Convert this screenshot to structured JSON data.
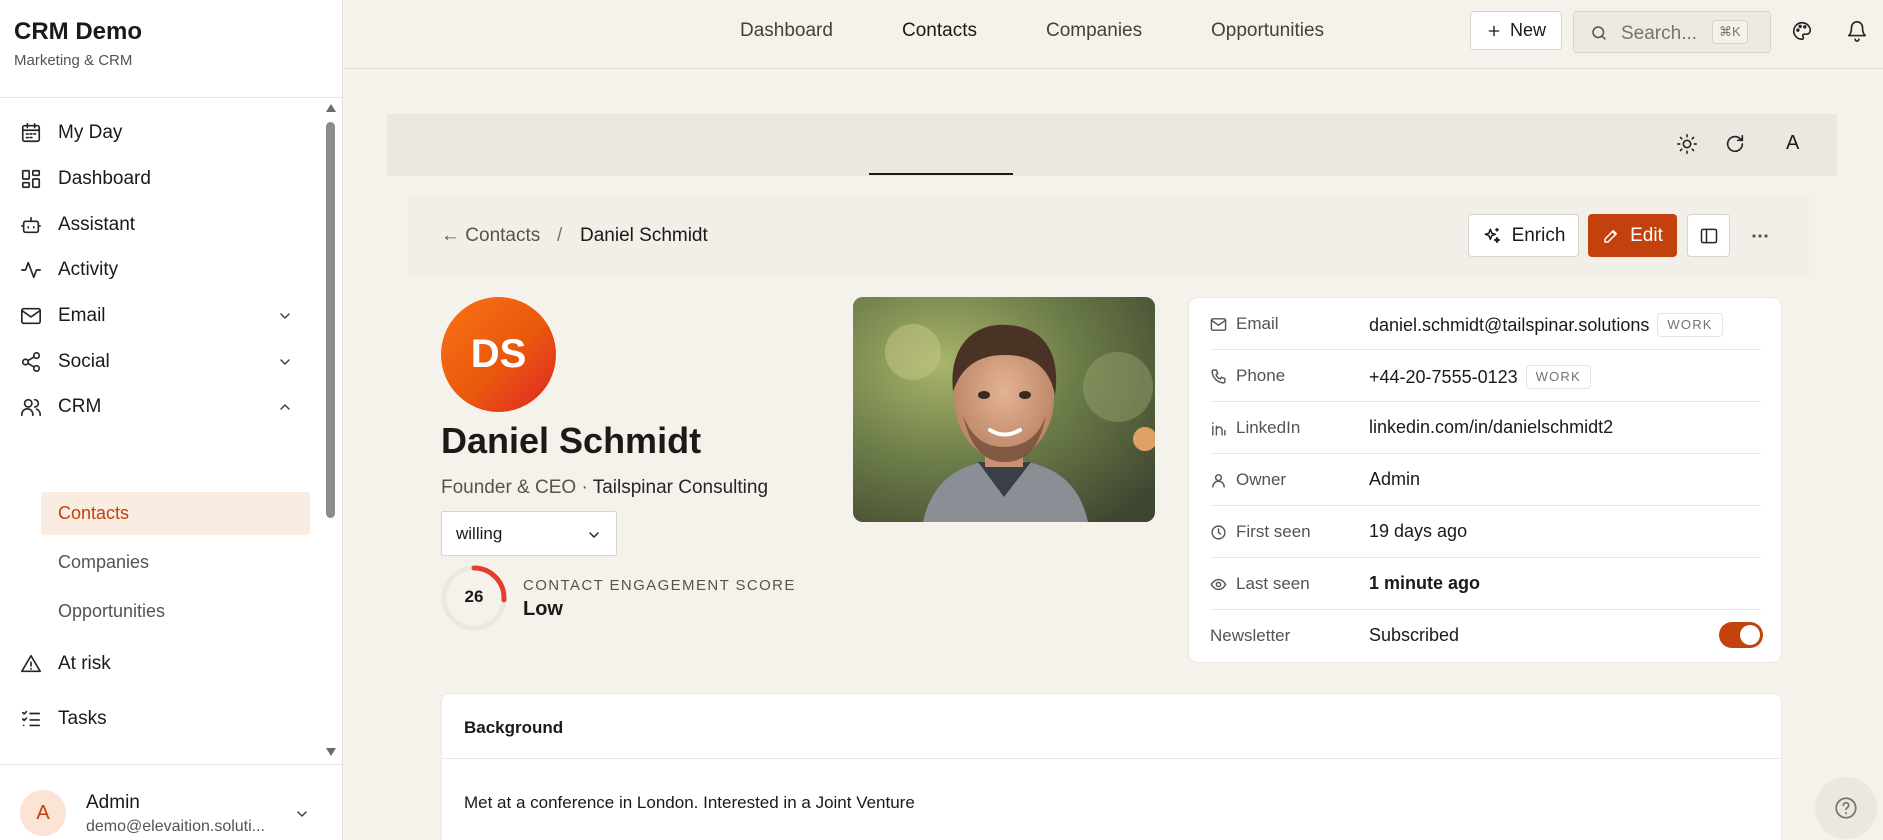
{
  "brand": {
    "title": "CRM Demo",
    "subtitle": "Marketing & CRM"
  },
  "sidebar": {
    "items": [
      {
        "label": "My Day",
        "icon": "calendar-icon"
      },
      {
        "label": "Dashboard",
        "icon": "dashboard-icon"
      },
      {
        "label": "Assistant",
        "icon": "bot-icon"
      },
      {
        "label": "Activity",
        "icon": "activity-icon"
      },
      {
        "label": "Email",
        "icon": "mail-icon",
        "expandable": true
      },
      {
        "label": "Social",
        "icon": "share-icon",
        "expandable": true
      },
      {
        "label": "CRM",
        "icon": "users-icon",
        "expanded": true
      },
      {
        "label": "At risk",
        "icon": "warning-icon"
      },
      {
        "label": "Tasks",
        "icon": "tasks-icon"
      }
    ],
    "crm_sub": [
      {
        "label": "Contacts",
        "active": true
      },
      {
        "label": "Companies"
      },
      {
        "label": "Opportunities"
      }
    ],
    "user": {
      "initial": "A",
      "name": "Admin",
      "email": "demo@elevaition.soluti..."
    }
  },
  "header": {
    "new_label": "New",
    "search_placeholder": "Search...",
    "search_shortcut": "⌘K"
  },
  "tabs": {
    "items": [
      {
        "label": "Dashboard"
      },
      {
        "label": "Contacts",
        "active": true
      },
      {
        "label": "Companies"
      },
      {
        "label": "Opportunities"
      }
    ],
    "avatar_letter": "A"
  },
  "breadcrumb": {
    "back": "Contacts",
    "separator": "/",
    "current": "Daniel Schmidt"
  },
  "actions": {
    "enrich": "Enrich",
    "edit": "Edit"
  },
  "contact": {
    "initials": "DS",
    "name": "Daniel Schmidt",
    "title": "Founder & CEO",
    "title_sep": "·",
    "company": "Tailspinar Consulting",
    "status": "willing",
    "engagement": {
      "score": "26",
      "score_fraction": 0.26,
      "title": "CONTACT ENGAGEMENT SCORE",
      "level": "Low"
    }
  },
  "details": {
    "email": {
      "label": "Email",
      "value": "daniel.schmidt@tailspinar.solutions",
      "badge": "WORK"
    },
    "phone": {
      "label": "Phone",
      "value": "+44-20-7555-0123",
      "badge": "WORK"
    },
    "linkedin": {
      "label": "LinkedIn",
      "value": "linkedin.com/in/danielschmidt2"
    },
    "owner": {
      "label": "Owner",
      "value": "Admin"
    },
    "first_seen": {
      "label": "First seen",
      "value": "19 days ago"
    },
    "last_seen": {
      "label": "Last seen",
      "value": "1 minute ago"
    },
    "newsletter": {
      "label": "Newsletter",
      "value": "Subscribed",
      "enabled": true
    }
  },
  "background": {
    "title": "Background",
    "text": "Met at a conference in London. Interested in a Joint Venture"
  },
  "colors": {
    "accent": "#c2410c",
    "page_bg": "#f5f2ec",
    "score_arc": "#e53e2e"
  }
}
